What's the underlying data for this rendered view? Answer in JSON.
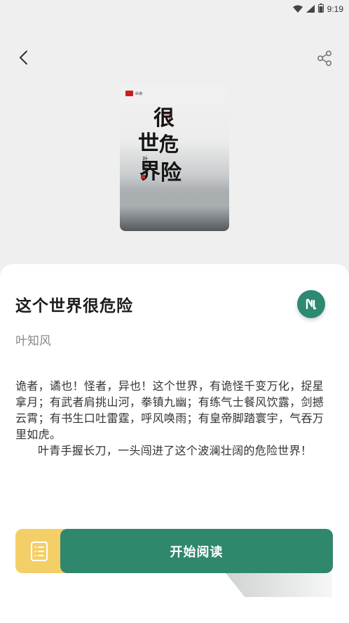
{
  "status_bar": {
    "time": "9:19"
  },
  "book": {
    "title": "这个世界很危险",
    "author": "叶知风",
    "cover": {
      "publisher": "纵横",
      "title_chars": [
        "很",
        "世",
        "危",
        "界",
        "险"
      ],
      "author": "叶知风"
    },
    "synopsis": [
      "诡者，谲也！怪者，异也！这个世界，有诡怪千变万化，捉星拿月；有武者肩挑山河，拳镇九幽；有练气士餐风饮露，剑撼云霄；有书生口吐雷霆，呼风唤雨；有皇帝脚踏寰宇，气吞万里如虎。",
      "叶青手握长刀，一头闯进了这个波澜壮阔的危险世界！"
    ]
  },
  "actions": {
    "read_label": "开始阅读"
  },
  "colors": {
    "accent": "#2f876d",
    "catalog": "#f4cf68",
    "background": "#efefef"
  },
  "icons": {
    "back": "chevron-left-icon",
    "share": "share-icon",
    "brand": "brand-badge-icon",
    "catalog": "list-icon",
    "wifi": "wifi-icon",
    "signal": "signal-icon",
    "battery": "battery-icon"
  }
}
